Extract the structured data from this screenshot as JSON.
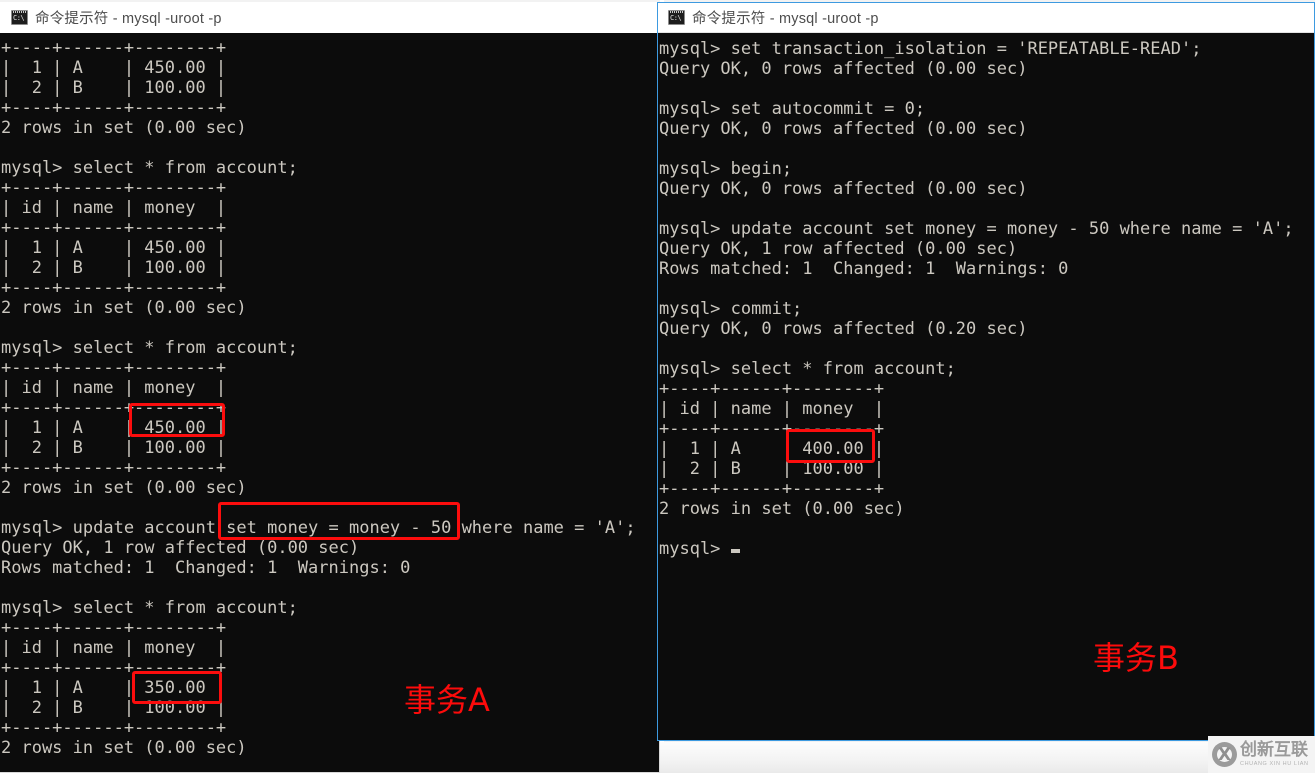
{
  "desktop": {
    "background_color": "#f2f2f2"
  },
  "colors": {
    "terminal_background": "#0c0c0c",
    "terminal_text": "#ccc8c0",
    "annotation_red": "#fc0d0d",
    "active_window_border": "#3d9ae0",
    "inactive_window_border": "#d9d9d9",
    "titlebar_background": "#ffffff",
    "titlebar_text": "#4d4d4d"
  },
  "left_window": {
    "title": "命令提示符 - mysql  -uroot -p",
    "icon": "cmd-icon",
    "icon_label": "C:\\",
    "active": false,
    "terminal_text": "+----+------+--------+\n|  1 | A    | 450.00 |\n|  2 | B    | 100.00 |\n+----+------+--------+\n2 rows in set (0.00 sec)\n\nmysql> select * from account;\n+----+------+--------+\n| id | name | money  |\n+----+------+--------+\n|  1 | A    | 450.00 |\n|  2 | B    | 100.00 |\n+----+------+--------+\n2 rows in set (0.00 sec)\n\nmysql> select * from account;\n+----+------+--------+\n| id | name | money  |\n+----+------+--------+\n|  1 | A    | 450.00 |\n|  2 | B    | 100.00 |\n+----+------+--------+\n2 rows in set (0.00 sec)\n\nmysql> update account set money = money - 50 where name = 'A';\nQuery OK, 1 row affected (0.00 sec)\nRows matched: 1  Changed: 1  Warnings: 0\n\nmysql> select * from account;\n+----+------+--------+\n| id | name | money  |\n+----+------+--------+\n|  1 | A    | 350.00 |\n|  2 | B    | 100.00 |\n+----+------+--------+\n2 rows in set (0.00 sec)\n",
    "label": "事务A"
  },
  "right_window": {
    "title": "命令提示符 - mysql  -uroot -p",
    "icon": "cmd-icon",
    "icon_label": "C:\\",
    "active": true,
    "terminal_text": "mysql> set transaction_isolation = 'REPEATABLE-READ';\nQuery OK, 0 rows affected (0.00 sec)\n\nmysql> set autocommit = 0;\nQuery OK, 0 rows affected (0.00 sec)\n\nmysql> begin;\nQuery OK, 0 rows affected (0.00 sec)\n\nmysql> update account set money = money - 50 where name = 'A';\nQuery OK, 1 row affected (0.00 sec)\nRows matched: 1  Changed: 1  Warnings: 0\n\nmysql> commit;\nQuery OK, 0 rows affected (0.20 sec)\n\nmysql> select * from account;\n+----+------+--------+\n| id | name | money  |\n+----+------+--------+\n|  1 | A    | 400.00 |\n|  2 | B    | 100.00 |\n+----+------+--------+\n2 rows in set (0.00 sec)\n\nmysql> ",
    "prompt_cursor": "block",
    "label": "事务B"
  },
  "annotations": [
    {
      "name": "highlight-450-left",
      "value": "450.00"
    },
    {
      "name": "highlight-update-stmt-left",
      "value": "set money = money - 50"
    },
    {
      "name": "highlight-350-left",
      "value": "350.00"
    },
    {
      "name": "highlight-400-right",
      "value": "400.00"
    }
  ],
  "watermark": {
    "logo": "x-circle-icon",
    "logo_letter": "X",
    "chinese": "创新互联",
    "pinyin": "CHUANG XIN HU LIAN"
  }
}
